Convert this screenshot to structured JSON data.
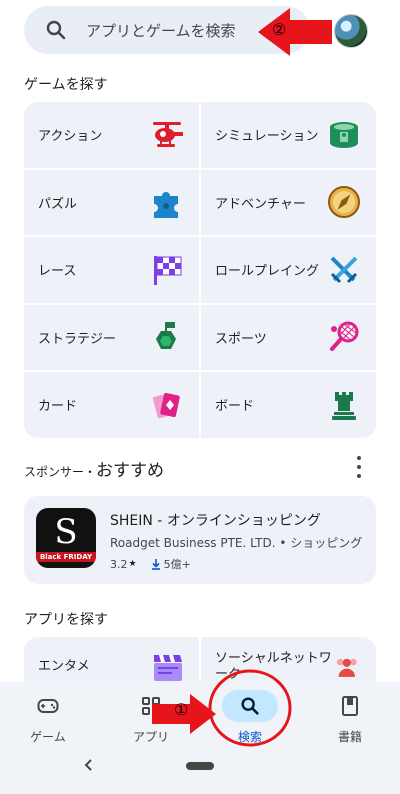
{
  "search": {
    "placeholder": "アプリとゲームを検索"
  },
  "games_section": {
    "title": "ゲームを探す",
    "categories": [
      {
        "label": "アクション",
        "icon": "helicopter-icon"
      },
      {
        "label": "シミュレーション",
        "icon": "stadium-icon"
      },
      {
        "label": "パズル",
        "icon": "puzzle-icon"
      },
      {
        "label": "アドベンチャー",
        "icon": "compass-icon"
      },
      {
        "label": "レース",
        "icon": "checkered-flag-icon"
      },
      {
        "label": "ロールプレイング",
        "icon": "crossed-swords-icon"
      },
      {
        "label": "ストラテジー",
        "icon": "strategy-flag-icon"
      },
      {
        "label": "スポーツ",
        "icon": "tennis-racket-icon"
      },
      {
        "label": "カード",
        "icon": "cards-icon"
      },
      {
        "label": "ボード",
        "icon": "chess-rook-icon"
      }
    ]
  },
  "sponsored": {
    "prefix": "スポンサー・",
    "title": "おすすめ",
    "app": {
      "icon_letter": "S",
      "icon_banner": "Black FRIDAY",
      "title": "SHEIN - オンラインショッピング",
      "subtitle": "Roadget Business PTE. LTD. • ショッピング",
      "rating": "3.2",
      "downloads": "5億+"
    }
  },
  "apps_section": {
    "title": "アプリを探す",
    "categories": [
      {
        "label": "エンタメ",
        "icon": "clapperboard-icon"
      },
      {
        "label": "ソーシャルネットワーク",
        "icon": "people-icon"
      }
    ]
  },
  "nav": {
    "items": [
      {
        "label": "ゲーム",
        "icon": "gamepad-icon",
        "active": false
      },
      {
        "label": "アプリ",
        "icon": "apps-grid-icon",
        "active": false
      },
      {
        "label": "検索",
        "icon": "search-icon",
        "active": true
      },
      {
        "label": "書籍",
        "icon": "book-icon",
        "active": false
      }
    ]
  },
  "annotations": {
    "marker_1": "①",
    "marker_2": "②",
    "arrow_color": "#e8141b"
  },
  "colors": {
    "accent": "#0b57d0",
    "active_pill": "#c2e7ff",
    "tile_bg": "#eef2f8"
  }
}
